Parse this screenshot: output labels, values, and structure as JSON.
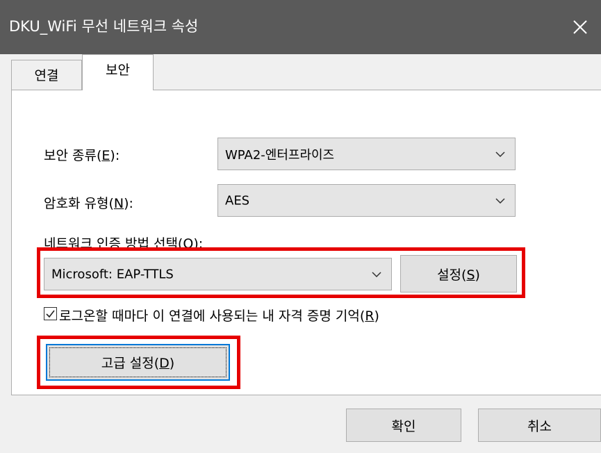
{
  "window": {
    "title": "DKU_WiFi 무선 네트워크 속성",
    "close_icon": "close-icon"
  },
  "tabs": [
    {
      "label": "연결",
      "active": false
    },
    {
      "label": "보안",
      "active": true
    }
  ],
  "security": {
    "type_label": "보안 종류",
    "type_mnemonic": "E",
    "type_value": "WPA2-엔터프라이즈",
    "encryption_label": "암호화 유형",
    "encryption_mnemonic": "N",
    "encryption_value": "AES",
    "auth_method_label": "네트워크 인증 방법 선택",
    "auth_method_mnemonic": "O",
    "auth_method_value": "Microsoft: EAP-TTLS",
    "settings_label": "설정",
    "settings_mnemonic": "S",
    "remember_label": "로그온할 때마다 이 연결에 사용되는 내 자격 증명 기억",
    "remember_mnemonic": "R",
    "remember_checked": true,
    "advanced_label": "고급 설정",
    "advanced_mnemonic": "D"
  },
  "footer": {
    "ok_label": "확인",
    "cancel_label": "취소"
  },
  "colors": {
    "titlebar": "#5a5a5a",
    "highlight": "#e60000",
    "focus": "#0078d7"
  }
}
